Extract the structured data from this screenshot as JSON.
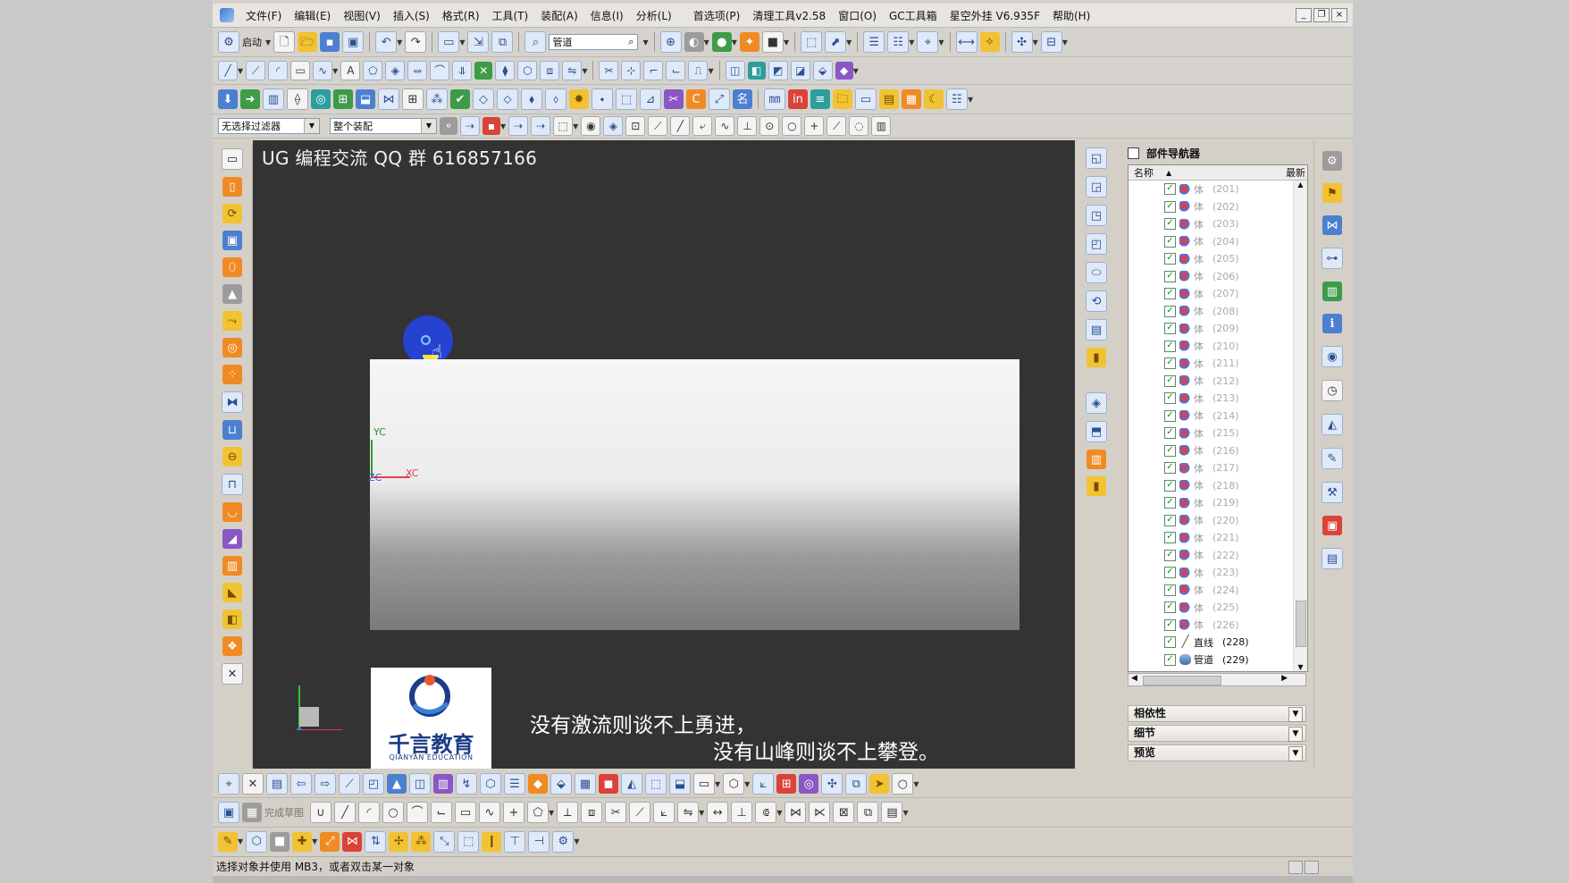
{
  "menubar": {
    "items": [
      "文件(F)",
      "编辑(E)",
      "视图(V)",
      "插入(S)",
      "格式(R)",
      "工具(T)",
      "装配(A)",
      "信息(I)",
      "分析(L)",
      "首选项(P)",
      "清理工具v2.58",
      "窗口(O)",
      "GC工具箱",
      "星空外挂 V6.935F",
      "帮助(H)"
    ]
  },
  "window_controls": [
    "_",
    "❐",
    "×"
  ],
  "toolbar1": {
    "start_label": "启动",
    "search_value": "管道"
  },
  "selection_bar": {
    "filter_value": "无选择过滤器",
    "scope_value": "整个装配"
  },
  "graphics": {
    "watermark": "UG 编程交流 QQ 群 616857166",
    "axis_labels": {
      "yc": "YC",
      "zc": "ZC",
      "xc": "XC"
    },
    "logo_cn": "千言教育",
    "logo_en": "QIANYAN EDUCATION",
    "caption_line1": "没有激流则谈不上勇进，",
    "caption_line2": "没有山峰则谈不上攀登。"
  },
  "navigator": {
    "title": "部件导航器",
    "col_name": "名称",
    "col_latest": "最新",
    "rows": [
      {
        "name": "体",
        "num": "(201)",
        "icon": "body"
      },
      {
        "name": "体",
        "num": "(202)",
        "icon": "body"
      },
      {
        "name": "体",
        "num": "(203)",
        "icon": "body"
      },
      {
        "name": "体",
        "num": "(204)",
        "icon": "body"
      },
      {
        "name": "体",
        "num": "(205)",
        "icon": "body"
      },
      {
        "name": "体",
        "num": "(206)",
        "icon": "body"
      },
      {
        "name": "体",
        "num": "(207)",
        "icon": "body"
      },
      {
        "name": "体",
        "num": "(208)",
        "icon": "body"
      },
      {
        "name": "体",
        "num": "(209)",
        "icon": "body"
      },
      {
        "name": "体",
        "num": "(210)",
        "icon": "body"
      },
      {
        "name": "体",
        "num": "(211)",
        "icon": "body"
      },
      {
        "name": "体",
        "num": "(212)",
        "icon": "body"
      },
      {
        "name": "体",
        "num": "(213)",
        "icon": "body"
      },
      {
        "name": "体",
        "num": "(214)",
        "icon": "body"
      },
      {
        "name": "体",
        "num": "(215)",
        "icon": "body"
      },
      {
        "name": "体",
        "num": "(216)",
        "icon": "body"
      },
      {
        "name": "体",
        "num": "(217)",
        "icon": "body"
      },
      {
        "name": "体",
        "num": "(218)",
        "icon": "body"
      },
      {
        "name": "体",
        "num": "(219)",
        "icon": "body"
      },
      {
        "name": "体",
        "num": "(220)",
        "icon": "body"
      },
      {
        "name": "体",
        "num": "(221)",
        "icon": "body"
      },
      {
        "name": "体",
        "num": "(222)",
        "icon": "body"
      },
      {
        "name": "体",
        "num": "(223)",
        "icon": "body"
      },
      {
        "name": "体",
        "num": "(224)",
        "icon": "body"
      },
      {
        "name": "体",
        "num": "(225)",
        "icon": "body"
      },
      {
        "name": "体",
        "num": "(226)",
        "icon": "body"
      },
      {
        "name": "直线",
        "num": "(228)",
        "icon": "line",
        "active": true
      },
      {
        "name": "管道",
        "num": "(229)",
        "icon": "pipe",
        "active": true
      }
    ],
    "sections": [
      "相依性",
      "细节",
      "预览"
    ]
  },
  "status": {
    "prompt": "选择对象并使用 MB3，或者双击某一对象"
  },
  "bottom_toolbar2": {
    "sketch_label": "完成草图"
  }
}
